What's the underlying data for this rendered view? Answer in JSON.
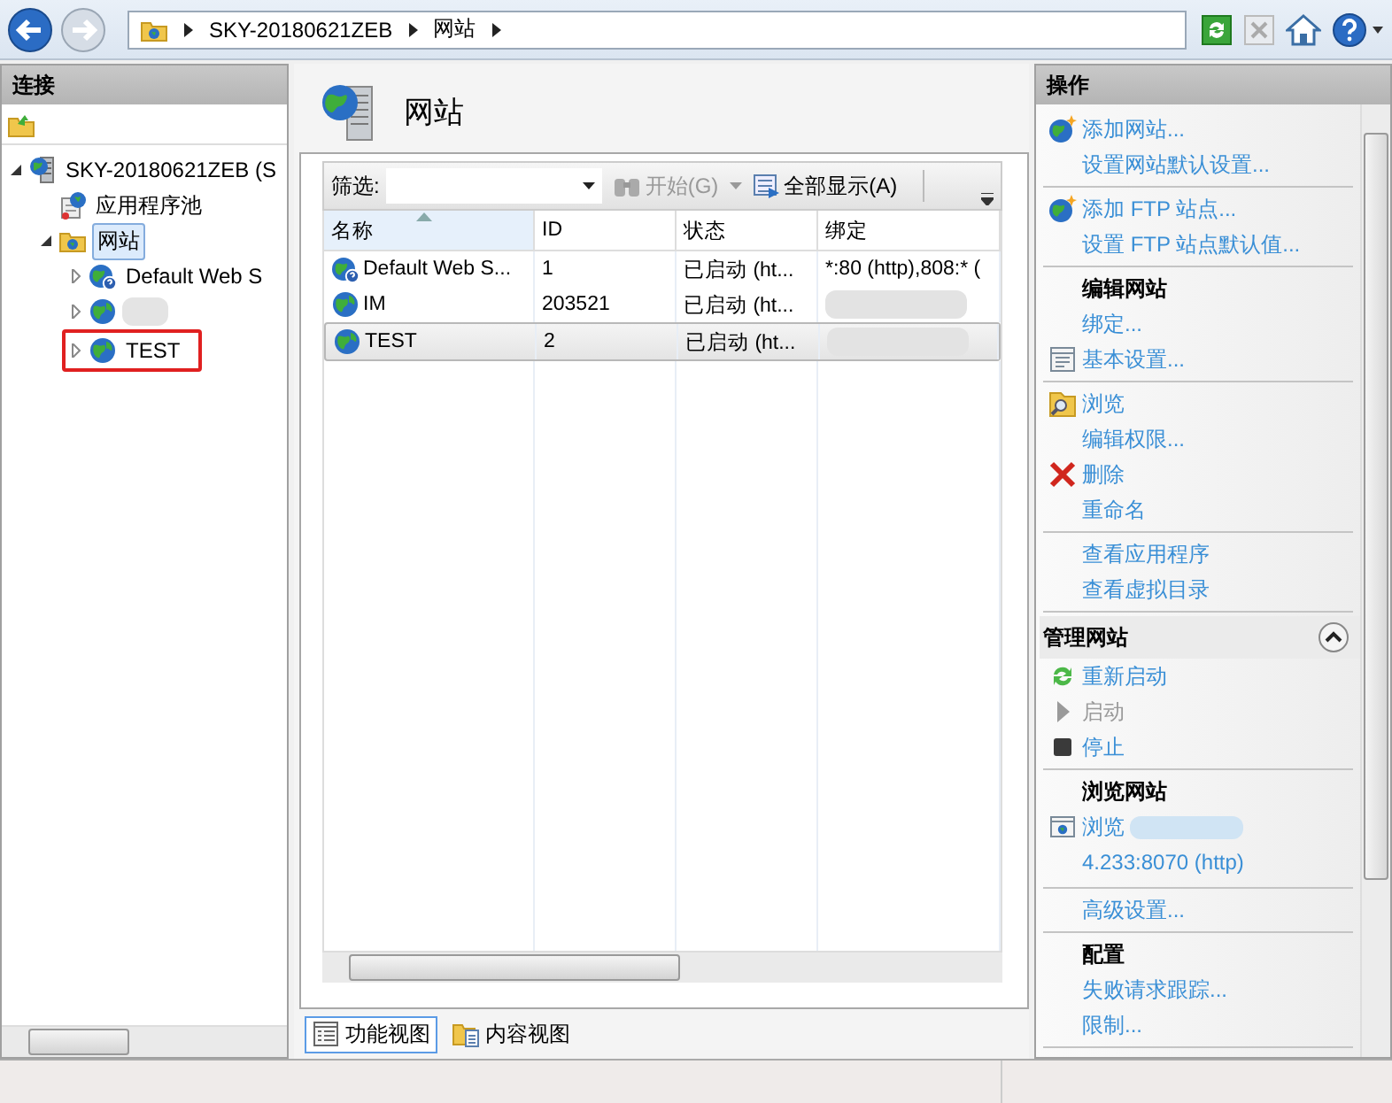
{
  "nav": {
    "crumbs": [
      "SKY-20180621ZEB",
      "网站"
    ]
  },
  "connections": {
    "title": "连接",
    "tree": [
      {
        "label": "SKY-20180621ZEB (S",
        "kind": "server",
        "expanded": true,
        "selected": false,
        "children": [
          {
            "label": "应用程序池",
            "kind": "pool",
            "selected": false
          },
          {
            "label": "网站",
            "kind": "folder",
            "expanded": true,
            "selected": true,
            "children": [
              {
                "label": "Default Web S",
                "kind": "site-default",
                "expanded": false,
                "selected": false
              },
              {
                "kind": "site",
                "expanded": false,
                "redacted": true
              },
              {
                "label": "TEST",
                "kind": "site",
                "expanded": false,
                "selected": false,
                "annotated": true
              }
            ]
          }
        ]
      }
    ]
  },
  "content": {
    "title": "网站",
    "filter": {
      "label": "筛选:",
      "start": "开始(G)",
      "start_disabled": true,
      "show_all": "全部显示(A)"
    },
    "table": {
      "columns": [
        {
          "label": "名称",
          "sorted": true
        },
        {
          "label": "ID",
          "sorted": false
        },
        {
          "label": "状态",
          "sorted": false
        },
        {
          "label": "绑定",
          "sorted": false
        }
      ],
      "rows": [
        {
          "kind": "site-default",
          "cells": [
            "Default Web S...",
            "1",
            "已启动 (ht...",
            "*:80 (http),808:* ("
          ],
          "selected": false
        },
        {
          "kind": "site",
          "cells": [
            "IM",
            "203521",
            "已启动 (ht..."
          ],
          "selected": false,
          "redacted": true
        },
        {
          "kind": "site",
          "cells": [
            "TEST",
            "2",
            "已启动 (ht..."
          ],
          "selected": true,
          "redacted": true
        }
      ]
    },
    "views": [
      {
        "label": "功能视图",
        "kind": "features",
        "selected": true
      },
      {
        "label": "内容视图",
        "kind": "content",
        "selected": false
      }
    ]
  },
  "actions": {
    "title": "操作",
    "sections": [
      {
        "items": [
          {
            "label": "添加网站...",
            "kind": "globe-star",
            "disabled": false
          },
          {
            "label": "设置网站默认设置...",
            "disabled": false
          }
        ]
      },
      {
        "items": [
          {
            "label": "添加 FTP 站点...",
            "kind": "globe-star",
            "disabled": false
          },
          {
            "label": "设置 FTP 站点默认值...",
            "disabled": false
          }
        ]
      },
      {
        "heading": "编辑网站",
        "items": [
          {
            "label": "绑定...",
            "disabled": false
          },
          {
            "label": "基本设置...",
            "kind": "window",
            "disabled": false
          }
        ]
      },
      {
        "items": [
          {
            "label": "浏览",
            "kind": "folder-search",
            "disabled": false
          },
          {
            "label": "编辑权限...",
            "disabled": false
          },
          {
            "label": "删除",
            "kind": "delete",
            "disabled": false
          },
          {
            "label": "重命名",
            "disabled": false
          }
        ]
      },
      {
        "items": [
          {
            "label": "查看应用程序",
            "disabled": false
          },
          {
            "label": "查看虚拟目录",
            "disabled": false
          }
        ]
      },
      {
        "group": "管理网站",
        "expanded": true,
        "items": [
          {
            "label": "重新启动",
            "kind": "restart",
            "disabled": false
          },
          {
            "label": "启动",
            "kind": "play",
            "disabled": true
          },
          {
            "label": "停止",
            "kind": "stop",
            "disabled": false
          }
        ]
      },
      {
        "heading": "浏览网站",
        "items": [
          {
            "label": "浏览",
            "tail": "4.233:8070 (http)",
            "kind": "browse",
            "disabled": false,
            "redacted": true
          }
        ]
      },
      {
        "items": [
          {
            "label": "高级设置...",
            "disabled": false
          }
        ]
      },
      {
        "heading": "配置",
        "items": [
          {
            "label": "失败请求跟踪...",
            "disabled": false
          },
          {
            "label": "限制...",
            "disabled": false
          }
        ]
      }
    ]
  }
}
